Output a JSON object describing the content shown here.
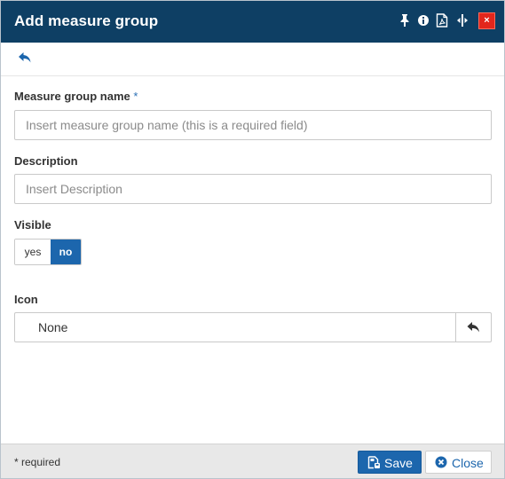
{
  "dialog": {
    "title": "Add measure group",
    "toolbar_icons": [
      "pin-icon",
      "info-icon",
      "pdf-icon",
      "resize-width-icon",
      "close-icon"
    ],
    "close_glyph": "×"
  },
  "form": {
    "name": {
      "label": "Measure group name",
      "required_marker": "*",
      "value": "",
      "placeholder": "Insert measure group name (this is a required field)"
    },
    "description": {
      "label": "Description",
      "value": "",
      "placeholder": "Insert Description"
    },
    "visible": {
      "label": "Visible",
      "options": [
        "yes",
        "no"
      ],
      "selected": "no"
    },
    "icon": {
      "label": "Icon",
      "value": "None"
    }
  },
  "footer": {
    "required_note": "* required",
    "save_label": "Save",
    "close_label": "Close"
  },
  "colors": {
    "titlebar": "#0e3f64",
    "primary": "#1c66ad",
    "close_red": "#e2261c",
    "footer_bg": "#e8e8e8"
  }
}
